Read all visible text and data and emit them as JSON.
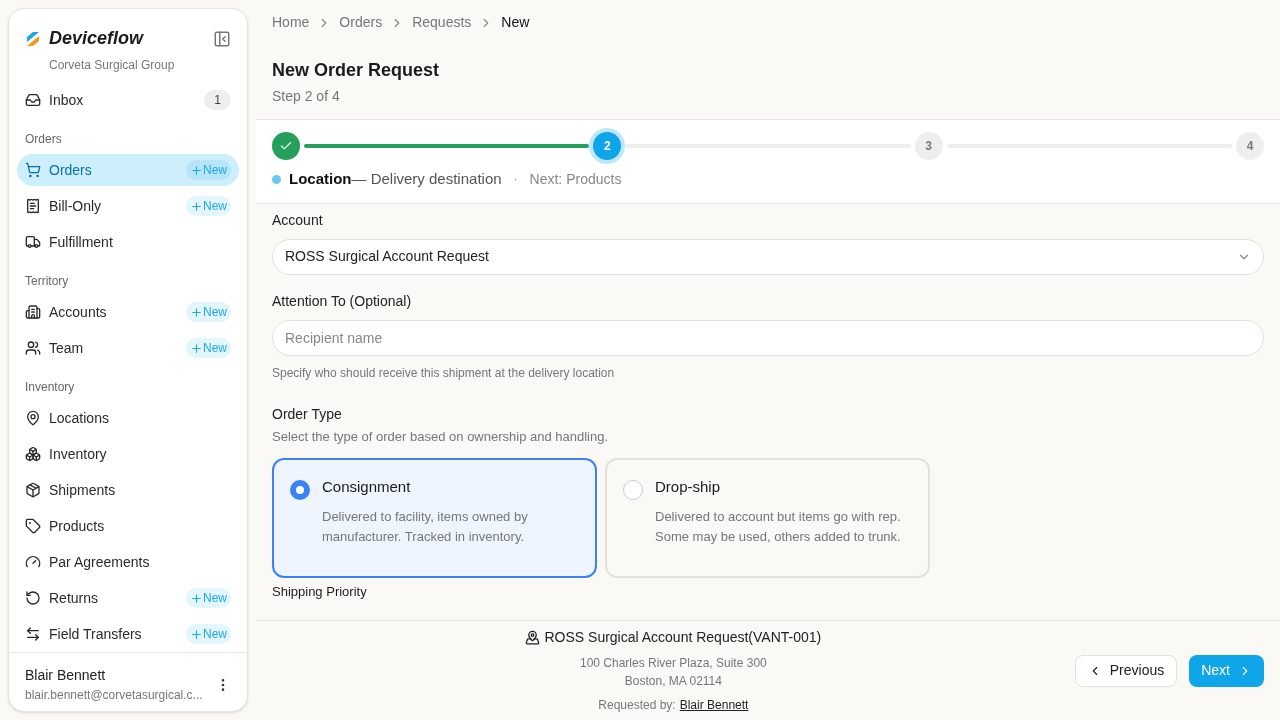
{
  "sidebar": {
    "brand": "Deviceflow",
    "org": "Corveta Surgical Group",
    "entries": [
      {
        "kind": "item",
        "label": "Inbox",
        "selected": false,
        "badge": "1"
      },
      {
        "kind": "heading",
        "label": "Orders"
      },
      {
        "kind": "item",
        "label": "Orders",
        "selected": true,
        "action": "New"
      },
      {
        "kind": "item",
        "label": "Bill-Only",
        "selected": false,
        "action": "New"
      },
      {
        "kind": "item",
        "label": "Fulfillment",
        "selected": false
      },
      {
        "kind": "heading",
        "label": "Territory"
      },
      {
        "kind": "item",
        "label": "Accounts",
        "selected": false,
        "action": "New"
      },
      {
        "kind": "item",
        "label": "Team",
        "selected": false,
        "action": "New"
      },
      {
        "kind": "heading",
        "label": "Inventory"
      },
      {
        "kind": "item",
        "label": "Locations",
        "selected": false
      },
      {
        "kind": "item",
        "label": "Inventory",
        "selected": false
      },
      {
        "kind": "item",
        "label": "Shipments",
        "selected": false
      },
      {
        "kind": "item",
        "label": "Products",
        "selected": false
      },
      {
        "kind": "item",
        "label": "Par Agreements",
        "selected": false
      },
      {
        "kind": "item",
        "label": "Returns",
        "selected": false,
        "action": "New"
      },
      {
        "kind": "item",
        "label": "Field Transfers",
        "selected": false,
        "action": "New"
      }
    ],
    "user": {
      "name": "Blair Bennett",
      "email": "blair.bennett@corvetasurgical.c..."
    }
  },
  "breadcrumb": [
    {
      "label": "Home",
      "selected": false
    },
    {
      "label": "Orders",
      "selected": false
    },
    {
      "label": "Requests",
      "selected": false
    },
    {
      "label": "New",
      "selected": true
    }
  ],
  "header": {
    "title": "New Order Request",
    "subtitle": "Step 2 of 4"
  },
  "stepper": {
    "steps": [
      {
        "done": true,
        "current": false
      },
      {
        "label": "2",
        "done": false,
        "current": true
      },
      {
        "label": "3",
        "done": false,
        "current": false
      },
      {
        "label": "4",
        "done": false,
        "current": false
      }
    ],
    "current_name": "Location",
    "current_desc": "— Delivery destination",
    "separator": "·",
    "next": "Next: Products"
  },
  "form": {
    "account": {
      "label": "Account",
      "value": "ROSS Surgical Account Request"
    },
    "attention": {
      "label": "Attention To (Optional)",
      "placeholder": "Recipient name",
      "hint": "Specify who should receive this shipment at the delivery location"
    },
    "order_type": {
      "label": "Order Type",
      "hint": "Select the type of order based on ownership and handling.",
      "options": [
        {
          "title": "Consignment",
          "desc": "Delivered to facility, items owned by manufacturer. Tracked in inventory.",
          "selected": true
        },
        {
          "title": "Drop-ship",
          "desc": "Delivered to account but items go with rep. Some may be used, others added to trunk.",
          "selected": false
        }
      ]
    },
    "next_section": "Shipping Priority"
  },
  "footer": {
    "account": "ROSS Surgical Account Request(VANT-001)",
    "address_1": "100 Charles River Plaza, Suite 300",
    "address_2": "Boston, MA 02114",
    "requested_label": "Requested by:",
    "requested_by": "Blair Bennett",
    "previous": "Previous",
    "next": "Next"
  }
}
